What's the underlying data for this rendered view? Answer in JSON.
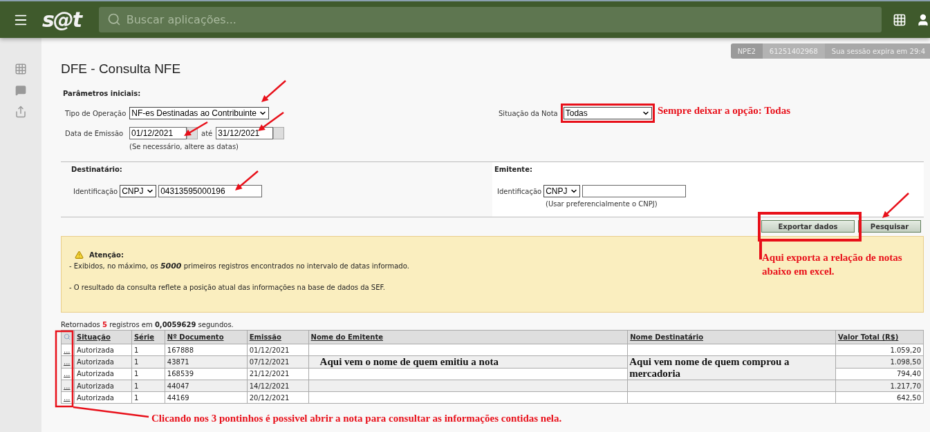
{
  "header": {
    "logo": "s@t",
    "search": {
      "placeholder": "Buscar aplicações..."
    }
  },
  "session": {
    "environment": "NPE2",
    "user": "61251402968",
    "expiry": "Sua sessão expira em 29:4"
  },
  "title": "DFE - Consulta NFE",
  "params": {
    "heading": "Parâmetros iniciais:",
    "operation": {
      "label": "Tipo de Operação",
      "value": "NF-es Destinadas ao Contribuinte"
    },
    "issue_date": {
      "label": "Data de Emissão",
      "from": "01/12/2021",
      "separator": "até",
      "to": "31/12/2021",
      "hint": "(Se necessário, altere as datas)"
    },
    "status": {
      "label": "Situação da Nota",
      "value": "Todas"
    }
  },
  "recipient": {
    "heading": "Destinatário:",
    "label": "Identificação",
    "id_type": "CNPJ",
    "value": "04313595000196"
  },
  "issuer": {
    "heading": "Emitente:",
    "label": "Identificação",
    "id_type": "CNPJ",
    "hint": "(Usar preferencialmente o CNPJ)"
  },
  "buttons": [
    "Exportar dados",
    "Pesquisar"
  ],
  "attention": {
    "title": "Atenção:",
    "lines": [
      "- Exibidos, no máximo, os **5000** primeiros registros encontrados no intervalo de datas informado.",
      "- O resultado da consulta reflete a posição atual das informações na base de dados da SEF."
    ]
  },
  "summary": {
    "before": "Retornados",
    "count": "5",
    "middle": "registros em",
    "time": "0,0059629",
    "after": "segundos."
  },
  "table": {
    "columns": [
      "Situação",
      "Série",
      "Nº Documento",
      "Emissão",
      "Nome do Emitente",
      "Nome Destinatário",
      "Valor Total (R$)"
    ],
    "rows": [
      {
        "link": "...",
        "status": "Autorizada",
        "series": "1",
        "document": "167888",
        "issued": "01/12/2021",
        "total": "1.059,20"
      },
      {
        "link": "...",
        "status": "Autorizada",
        "series": "1",
        "document": "43871",
        "issued": "07/12/2021",
        "total": "1.098,50"
      },
      {
        "link": "...",
        "status": "Autorizada",
        "series": "1",
        "document": "168539",
        "issued": "21/12/2021",
        "total": "794,40"
      },
      {
        "link": "...",
        "status": "Autorizada",
        "series": "1",
        "document": "44047",
        "issued": "14/12/2021",
        "total": "1.217,70"
      },
      {
        "link": "...",
        "status": "Autorizada",
        "series": "1",
        "document": "44169",
        "issued": "20/12/2021",
        "total": "642,50"
      }
    ]
  },
  "notes": [
    "Sempre deixar a opção: Todas",
    "Aqui exporta a relação de notas abaixo em excel.",
    "Aqui vem o nome de quem emitiu a nota",
    "Aqui vem nome de quem comprou a mercadoria",
    "Clicando nos 3 pontinhos é possivel abrir a nota para consultar as informações contidas nela."
  ]
}
